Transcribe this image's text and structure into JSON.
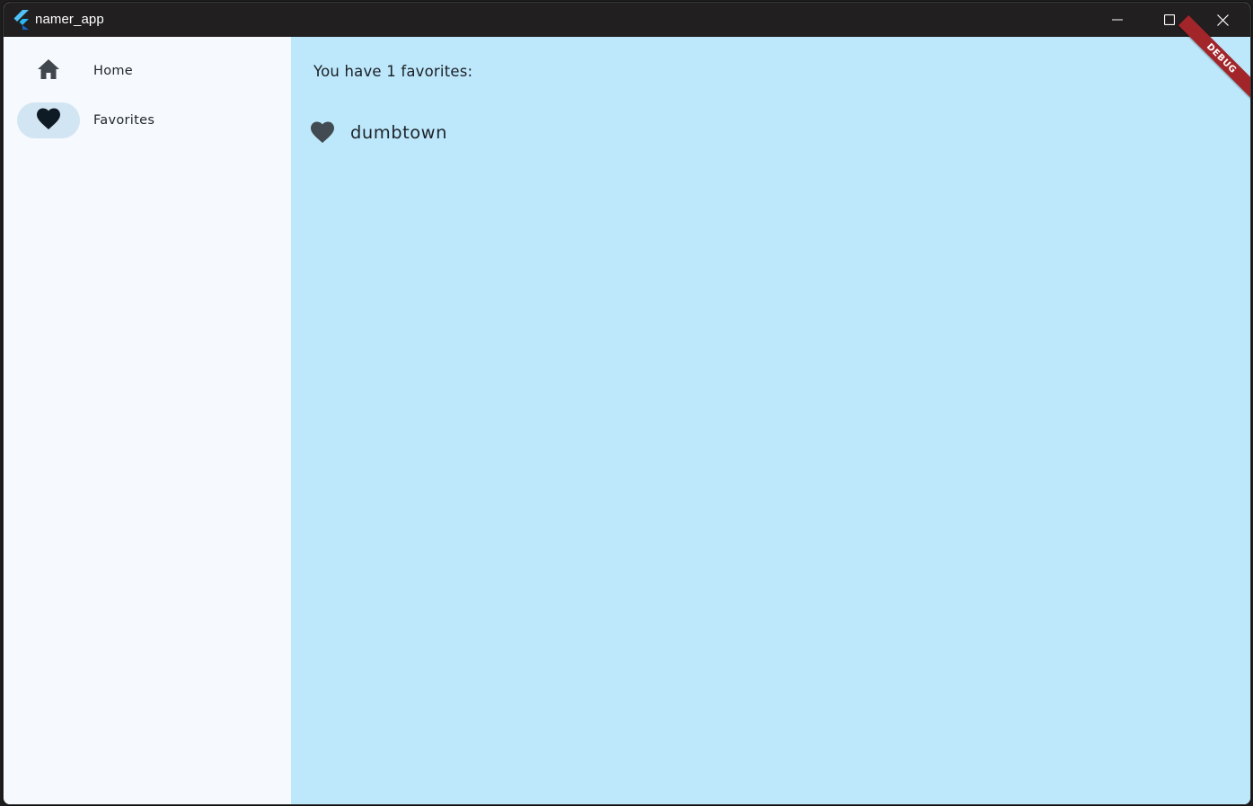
{
  "window": {
    "title": "namer_app",
    "app_icon": "flutter-logo-icon",
    "controls": {
      "minimize_icon": "minimize-icon",
      "maximize_icon": "maximize-icon",
      "close_icon": "close-icon"
    }
  },
  "navigation_rail": {
    "items": [
      {
        "label": "Home",
        "icon": "home-icon",
        "selected": false
      },
      {
        "label": "Favorites",
        "icon": "favorite-heart-icon",
        "selected": true
      }
    ],
    "selected_indicator_color": "#d2e5f3"
  },
  "favorites_page": {
    "heading": "You have 1 favorites:",
    "items": [
      {
        "name": "dumbtown",
        "icon": "favorite-heart-icon"
      }
    ],
    "background_color": "#bde8fc"
  },
  "debug_banner": {
    "text": "DEBUG",
    "color": "#a2252a"
  }
}
